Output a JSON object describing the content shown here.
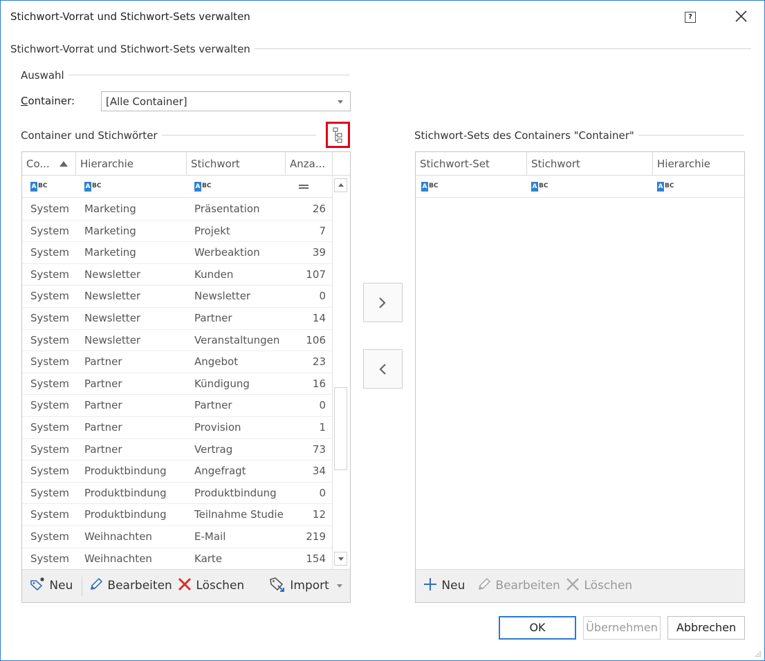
{
  "window": {
    "title": "Stichwort-Vorrat und Stichwort-Sets verwalten",
    "help": "?"
  },
  "main_group": {
    "title": "Stichwort-Vorrat und Stichwort-Sets verwalten"
  },
  "auswahl": {
    "title": "Auswahl",
    "container_label": "Container:",
    "container_value": "[Alle Container]"
  },
  "left": {
    "title": "Container und Stichwörter",
    "columns": [
      "Co...",
      "Hierarchie",
      "Stichwort",
      "Anza..."
    ],
    "rows": [
      [
        "System",
        "Marketing",
        "Präsentation",
        "26"
      ],
      [
        "System",
        "Marketing",
        "Projekt",
        "7"
      ],
      [
        "System",
        "Marketing",
        "Werbeaktion",
        "39"
      ],
      [
        "System",
        "Newsletter",
        "Kunden",
        "107"
      ],
      [
        "System",
        "Newsletter",
        "Newsletter",
        "0"
      ],
      [
        "System",
        "Newsletter",
        "Partner",
        "14"
      ],
      [
        "System",
        "Newsletter",
        "Veranstaltungen",
        "106"
      ],
      [
        "System",
        "Partner",
        "Angebot",
        "23"
      ],
      [
        "System",
        "Partner",
        "Kündigung",
        "16"
      ],
      [
        "System",
        "Partner",
        "Partner",
        "0"
      ],
      [
        "System",
        "Partner",
        "Provision",
        "1"
      ],
      [
        "System",
        "Partner",
        "Vertrag",
        "73"
      ],
      [
        "System",
        "Produktbindung",
        "Angefragt",
        "34"
      ],
      [
        "System",
        "Produktbindung",
        "Produktbindung",
        "0"
      ],
      [
        "System",
        "Produktbindung",
        "Teilnahme Studie",
        "12"
      ],
      [
        "System",
        "Weihnachten",
        "E-Mail",
        "219"
      ],
      [
        "System",
        "Weihnachten",
        "Karte",
        "154"
      ]
    ],
    "toolbar": {
      "neu": "Neu",
      "bearbeiten": "Bearbeiten",
      "loeschen": "Löschen",
      "import": "Import"
    }
  },
  "right": {
    "title": "Stichwort-Sets des Containers \"Container\"",
    "columns": [
      "Stichwort-Set",
      "Stichwort",
      "Hierarchie"
    ],
    "toolbar": {
      "neu": "Neu",
      "bearbeiten": "Bearbeiten",
      "loeschen": "Löschen"
    }
  },
  "abc_icon": {
    "a": "A",
    "bc": "BC"
  },
  "buttons": {
    "ok": "OK",
    "apply": "Übernehmen",
    "cancel": "Abbrechen"
  },
  "colors": {
    "accent": "#2b79d1",
    "highlight": "#e0001a",
    "icon_blue": "#2d82d2",
    "delete_red": "#d9302c"
  }
}
